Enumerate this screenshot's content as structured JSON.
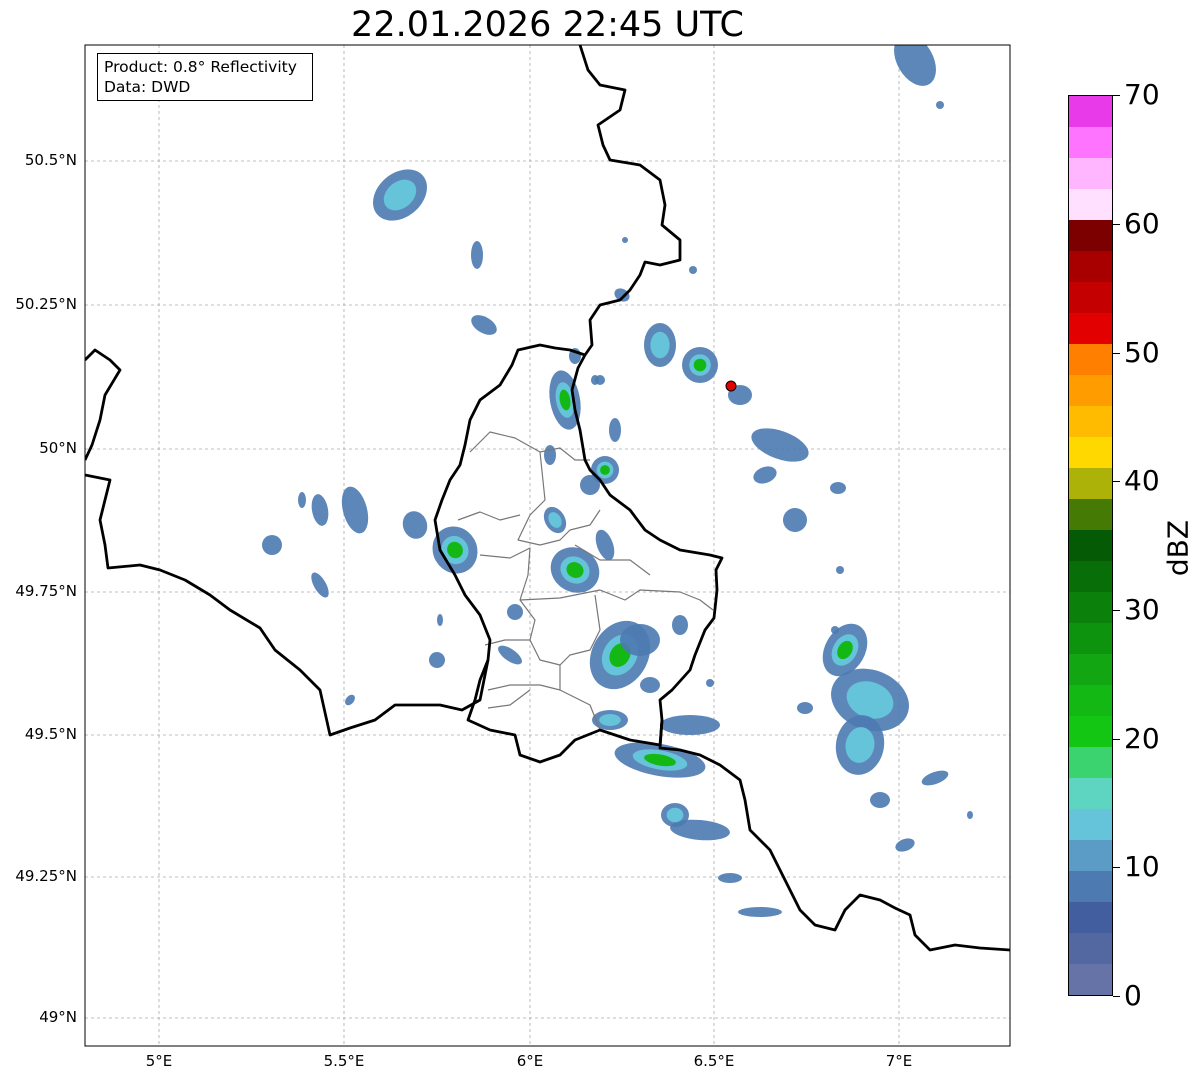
{
  "title": "22.01.2026 22:45 UTC",
  "info_box": {
    "product": "Product: 0.8° Reflectivity",
    "data_source": "Data: DWD"
  },
  "map": {
    "lat_ticks": [
      "50.5°N",
      "50.25°N",
      "50°N",
      "49.75°N",
      "49.5°N",
      "49.25°N",
      "49°N"
    ],
    "lon_ticks": [
      "5°E",
      "5.5°E",
      "6°E",
      "6.5°E",
      "7°E"
    ],
    "extent": {
      "lon_min": 4.8,
      "lon_max": 7.3,
      "lat_min": 48.95,
      "lat_max": 50.7
    },
    "gridlines": true,
    "radar_site_color": "#e00000"
  },
  "colorbar": {
    "unit": "dBZ",
    "tick_labels": [
      "0",
      "10",
      "20",
      "30",
      "40",
      "50",
      "60",
      "70"
    ],
    "range": [
      0,
      70
    ],
    "colors": [
      "#6673a6",
      "#5367a0",
      "#425e9f",
      "#4c7ab1",
      "#5b9cc7",
      "#65c3da",
      "#5dd5c0",
      "#3ad36f",
      "#14c614",
      "#14b814",
      "#12a612",
      "#0e930e",
      "#0b810b",
      "#086f08",
      "#055b05",
      "#457a05",
      "#adb208",
      "#ffd800",
      "#ffbb00",
      "#ff9d00",
      "#ff7f00",
      "#e20000",
      "#c40000",
      "#a80000",
      "#7d0000",
      "#ffe0ff",
      "#ffb6ff",
      "#ff74ff",
      "#e93ae9"
    ]
  }
}
